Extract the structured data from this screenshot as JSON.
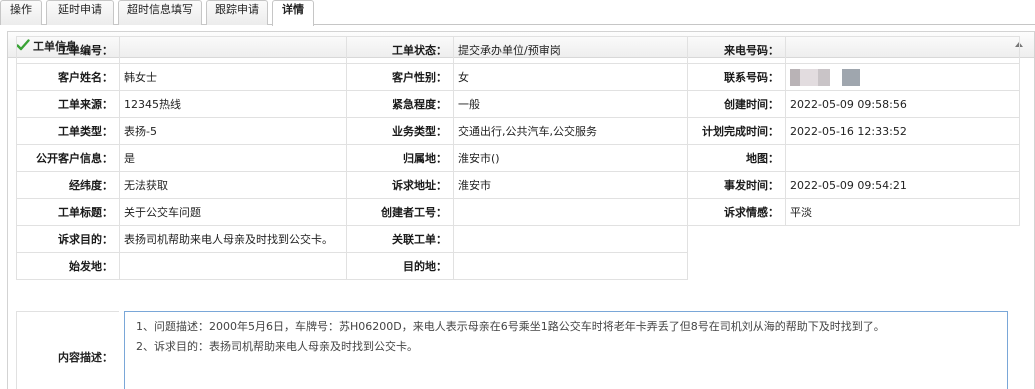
{
  "tabs": [
    "操作",
    "延时申请",
    "超时信息填写",
    "跟踪申请",
    "详情"
  ],
  "panel": {
    "title": "工单信息"
  },
  "rows": [
    [
      {
        "label": "工单编号：",
        "value": ""
      },
      {
        "label": "工单状态：",
        "value": "提交承办单位/预审岗"
      },
      {
        "label": "来电号码：",
        "value": ""
      }
    ],
    [
      {
        "label": "客户姓名：",
        "value": "韩女士"
      },
      {
        "label": "客户性别：",
        "value": "女"
      },
      {
        "label": "联系号码：",
        "value": ""
      }
    ],
    [
      {
        "label": "工单来源：",
        "value": "12345热线"
      },
      {
        "label": "紧急程度：",
        "value": "一般"
      },
      {
        "label": "创建时间：",
        "value": "2022-05-09 09:58:56"
      }
    ],
    [
      {
        "label": "工单类型：",
        "value": "表扬-5"
      },
      {
        "label": "业务类型：",
        "value": "交通出行,公共汽车,公交服务"
      },
      {
        "label": "计划完成时间：",
        "value": "2022-05-16 12:33:52"
      }
    ],
    [
      {
        "label": "公开客户信息：",
        "value": "是"
      },
      {
        "label": "归属地：",
        "value": "淮安市()"
      },
      {
        "label": "地图：",
        "value": ""
      }
    ],
    [
      {
        "label": "经纬度：",
        "value": "无法获取"
      },
      {
        "label": "诉求地址：",
        "value": "淮安市"
      },
      {
        "label": "事发时间：",
        "value": "2022-05-09 09:54:21"
      }
    ],
    [
      {
        "label": "工单标题：",
        "value": "关于公交车问题"
      },
      {
        "label": "创建者工号：",
        "value": ""
      },
      {
        "label": "诉求情感：",
        "value": "平淡"
      }
    ],
    [
      {
        "label": "诉求目的：",
        "value": "表扬司机帮助来电人母亲及时找到公交卡。"
      },
      {
        "label": "关联工单：",
        "value": ""
      }
    ],
    [
      {
        "label": "始发地：",
        "value": ""
      },
      {
        "label": "目的地：",
        "value": ""
      }
    ]
  ],
  "content": {
    "label": "内容描述：",
    "lines": [
      "1、问题描述：2000年5月6日，车牌号：苏H06200D，来电人表示母亲在6号乘坐1路公交车时将老年卡弄丢了但8号在司机刘从海的帮助下及时找到了。",
      "2、诉求目的：表扬司机帮助来电人母亲及时找到公交卡。"
    ]
  },
  "colors": {
    "check": "#3aa336",
    "border": "#e1e1e1",
    "textarea_border": "#7aa7d8"
  }
}
